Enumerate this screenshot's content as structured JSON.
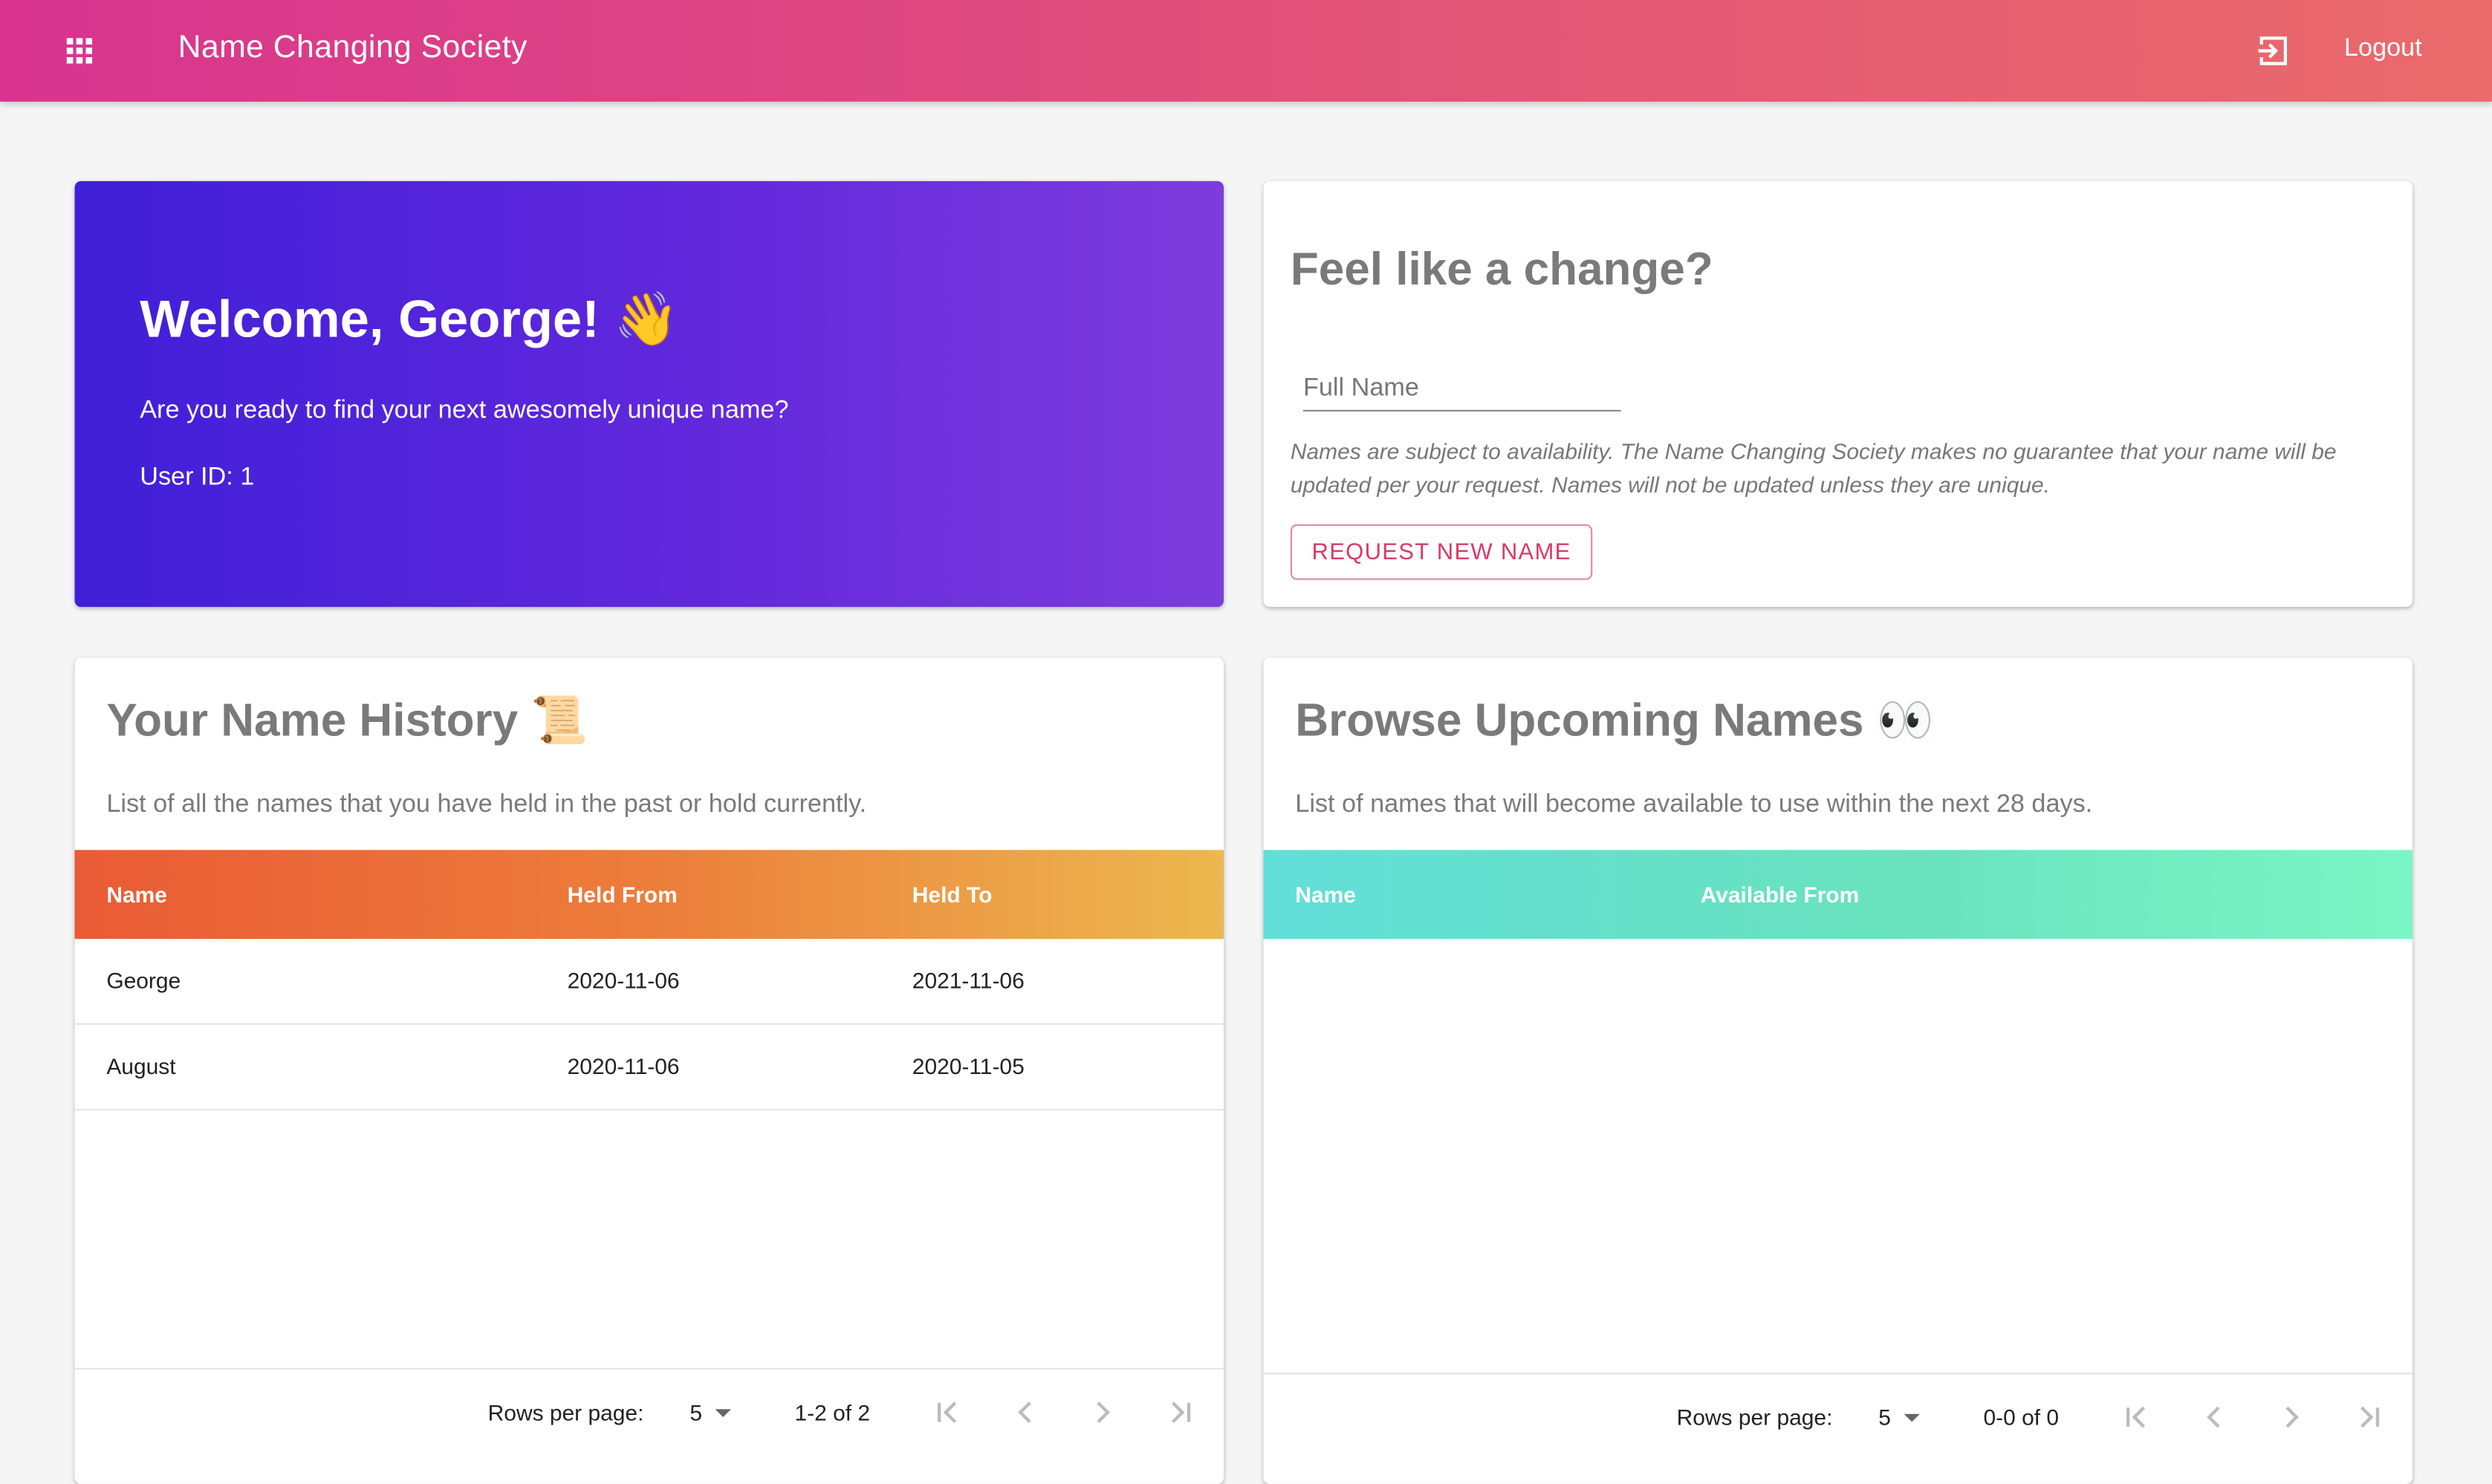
{
  "appbar": {
    "title": "Name Changing Society",
    "logout_label": "Logout",
    "apps_icon": "apps-grid-icon",
    "logout_icon": "logout-icon"
  },
  "welcome": {
    "title": "Welcome, George! 👋",
    "subtitle": "Are you ready to find your next awesomely unique name?",
    "user_id": "User ID: 1"
  },
  "change": {
    "title": "Feel like a change?",
    "input_placeholder": "Full Name",
    "input_value": "",
    "disclaimer": "Names are subject to availability. The Name Changing Society makes no guarantee that your name will be updated per your request. Names will not be updated unless they are unique.",
    "button_label": "REQUEST NEW NAME"
  },
  "history": {
    "title": "Your Name History 📜",
    "description": "List of all the names that you have held in the past or hold currently.",
    "columns": [
      "Name",
      "Held From",
      "Held To"
    ],
    "rows": [
      [
        "George",
        "2020-11-06",
        "2021-11-06"
      ],
      [
        "August",
        "2020-11-06",
        "2020-11-05"
      ]
    ],
    "pager": {
      "rows_per_page_label": "Rows per page:",
      "rows_per_page": "5",
      "range": "1-2 of 2"
    }
  },
  "upcoming": {
    "title": "Browse Upcoming Names 👀",
    "description": "List of names that will become available to use within the next 28 days.",
    "columns": [
      "Name",
      "Available From"
    ],
    "rows": [],
    "pager": {
      "rows_per_page_label": "Rows per page:",
      "rows_per_page": "5",
      "range": "0-0 of 0"
    }
  },
  "colors": {
    "appbar_start": "#d8348f",
    "appbar_end": "#ea6b6b",
    "welcome_start": "#3f1fd8",
    "welcome_end": "#7d3cdc",
    "accent": "#d83a6b"
  }
}
